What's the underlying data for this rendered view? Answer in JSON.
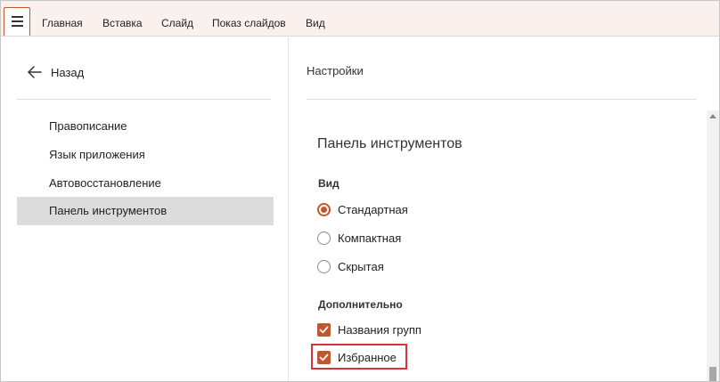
{
  "menubar": {
    "menu_icon": "hamburger-icon",
    "items": [
      "Главная",
      "Вставка",
      "Слайд",
      "Показ слайдов",
      "Вид"
    ]
  },
  "left": {
    "back_icon": "arrow-left-icon",
    "back_label": "Назад",
    "nav_items": [
      "Правописание",
      "Язык приложения",
      "Автовосстановление",
      "Панель инструментов"
    ],
    "active_item": "Панель инструментов"
  },
  "right": {
    "settings_title": "Настройки",
    "section_title": "Панель инструментов",
    "view_label": "Вид",
    "view_options": [
      {
        "label": "Стандартная",
        "checked": true
      },
      {
        "label": "Компактная",
        "checked": false
      },
      {
        "label": "Скрытая",
        "checked": false
      }
    ],
    "extra_label": "Дополнительно",
    "extra_options": [
      {
        "label": "Названия групп",
        "checked": true
      },
      {
        "label": "Избранное",
        "checked": true
      }
    ]
  },
  "colors": {
    "accent": "#c0582f",
    "highlight_border": "#d4343a",
    "menubar_bg": "#faf0ed",
    "active_nav_bg": "#dcdcdc"
  }
}
